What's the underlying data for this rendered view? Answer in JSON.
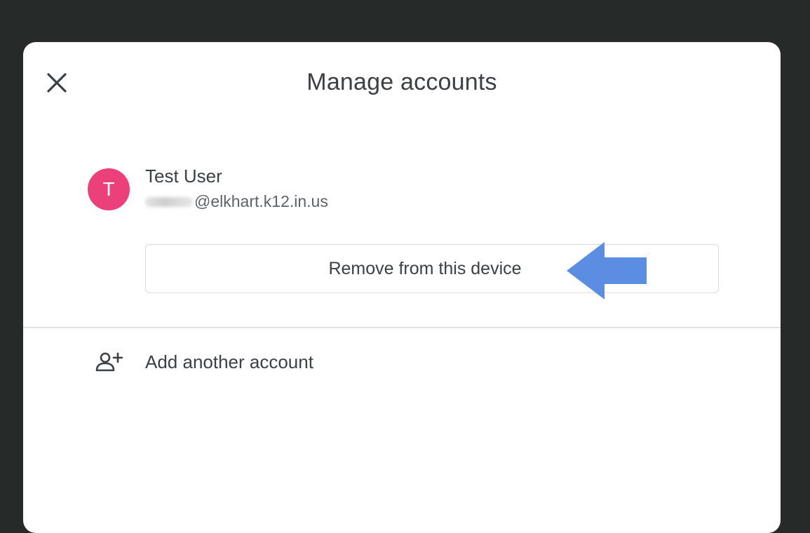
{
  "dialog": {
    "title": "Manage accounts",
    "close_icon": "close-icon"
  },
  "account": {
    "avatar_initial": "T",
    "avatar_color": "#ec407a",
    "name": "Test User",
    "email_domain": "@elkhart.k12.in.us"
  },
  "actions": {
    "remove_label": "Remove from this device",
    "add_account_label": "Add another account",
    "add_account_icon": "person-add-icon"
  },
  "annotation": {
    "arrow_color": "#5b8ee3",
    "arrow_icon": "left-arrow-annotation"
  }
}
